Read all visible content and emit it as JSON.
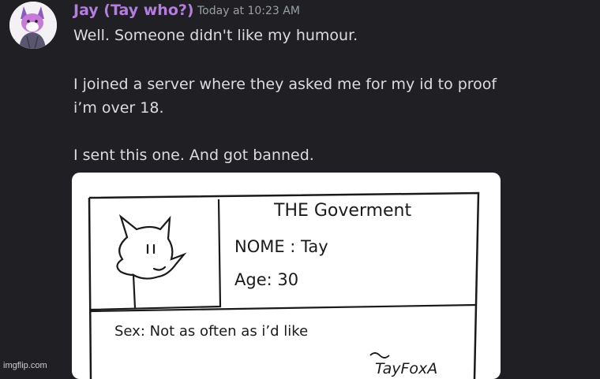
{
  "message": {
    "author": "Jay (Tay who?)",
    "timestamp": "Today at 10:23 AM",
    "lines": [
      "Well. Someone didn't like my humour.",
      "I joined a server where they asked me for my id to proof",
      "i’m over 18.",
      "I sent this one. And got banned."
    ],
    "author_color": "#b57de0"
  },
  "attachment": {
    "title": "THE Goverment",
    "name_line": "NOME : Tay",
    "age_line": "Age: 30",
    "sex_line": "Sex: Not as often as i’d like",
    "signature": "TayFoxA"
  },
  "watermark": "imgflip.com"
}
